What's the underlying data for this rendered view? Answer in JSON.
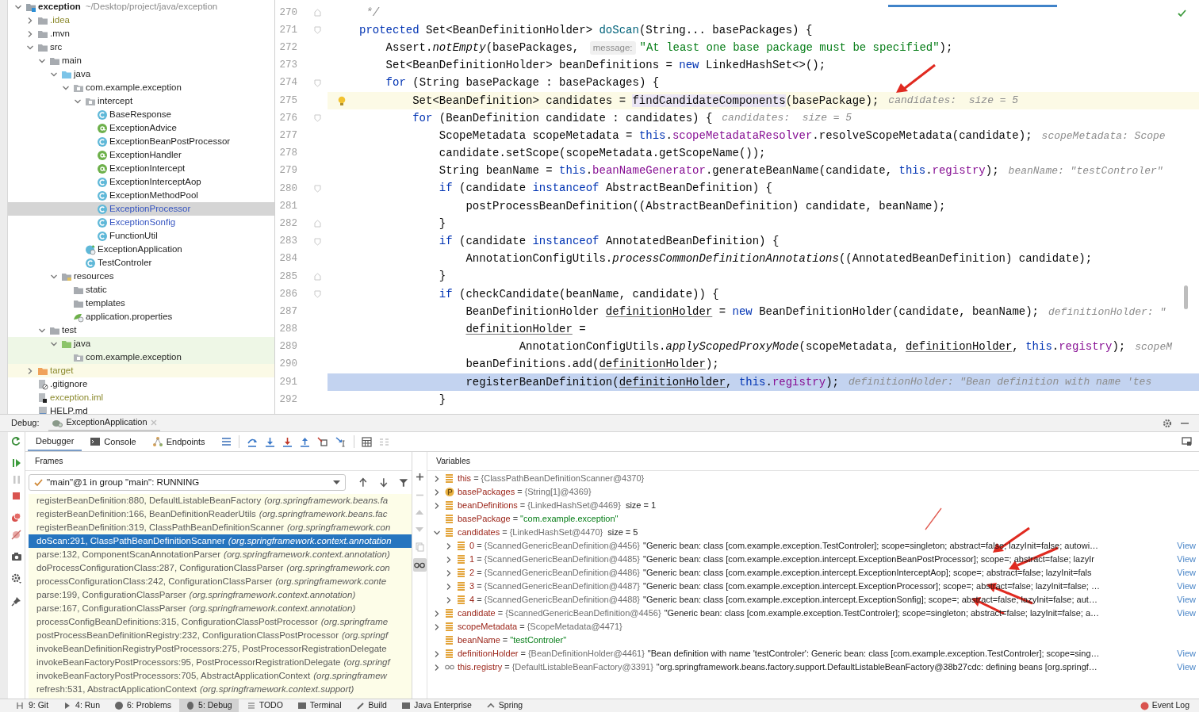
{
  "project_tree": [
    {
      "label": "exception",
      "path": "~/Desktop/project/java/exception",
      "kind": "module",
      "expanded": true,
      "selected": false,
      "children": [
        {
          "label": ".idea",
          "kind": "folder",
          "expanded": false,
          "selected": false,
          "ignored": true
        },
        {
          "label": ".mvn",
          "kind": "folder",
          "expanded": false,
          "selected": false
        },
        {
          "label": "src",
          "kind": "folder",
          "expanded": true,
          "selected": false,
          "children": [
            {
              "label": "main",
              "kind": "folder",
              "expanded": true,
              "selected": false,
              "children": [
                {
                  "label": "java",
                  "kind": "source_folder",
                  "expanded": true,
                  "selected": false,
                  "children": [
                    {
                      "label": "com.example.exception",
                      "kind": "package",
                      "expanded": true,
                      "selected": false,
                      "children": [
                        {
                          "label": "intercept",
                          "kind": "package",
                          "expanded": true,
                          "selected": false,
                          "children": [
                            {
                              "label": "BaseResponse",
                              "kind": "class",
                              "selected": false
                            },
                            {
                              "label": "ExceptionAdvice",
                              "kind": "annotation",
                              "selected": false
                            },
                            {
                              "label": "ExceptionBeanPostProcessor",
                              "kind": "class",
                              "selected": false
                            },
                            {
                              "label": "ExceptionHandler",
                              "kind": "annotation",
                              "selected": false
                            },
                            {
                              "label": "ExceptionIntercept",
                              "kind": "annotation",
                              "selected": false
                            },
                            {
                              "label": "ExceptionInterceptAop",
                              "kind": "class",
                              "selected": false
                            },
                            {
                              "label": "ExceptionMethodPool",
                              "kind": "class",
                              "selected": false
                            },
                            {
                              "label": "ExceptionProcessor",
                              "kind": "class",
                              "selected": true,
                              "modified": true
                            },
                            {
                              "label": "ExceptionSonfig",
                              "kind": "class",
                              "selected": false,
                              "modified": true
                            },
                            {
                              "label": "FunctionUtil",
                              "kind": "class",
                              "selected": false
                            }
                          ]
                        },
                        {
                          "label": "ExceptionApplication",
                          "kind": "spring_app",
                          "selected": false
                        },
                        {
                          "label": "TestControler",
                          "kind": "class",
                          "selected": false
                        }
                      ]
                    }
                  ]
                },
                {
                  "label": "resources",
                  "kind": "resources",
                  "expanded": true,
                  "selected": false,
                  "children": [
                    {
                      "label": "static",
                      "kind": "folder",
                      "selected": false
                    },
                    {
                      "label": "templates",
                      "kind": "folder",
                      "selected": false
                    },
                    {
                      "label": "application.properties",
                      "kind": "properties",
                      "selected": false
                    }
                  ]
                }
              ]
            },
            {
              "label": "test",
              "kind": "folder",
              "expanded": true,
              "selected": false,
              "children": [
                {
                  "label": "java",
                  "kind": "test_folder",
                  "expanded": true,
                  "selected": false,
                  "test_scope": true,
                  "children": [
                    {
                      "label": "com.example.exception",
                      "kind": "package",
                      "selected": false,
                      "test_scope": true
                    }
                  ]
                }
              ]
            }
          ]
        },
        {
          "label": "target",
          "kind": "excluded_folder",
          "expanded": false,
          "selected": false,
          "ignored": true,
          "excluded": true
        },
        {
          "label": ".gitignore",
          "kind": "ignore_file",
          "selected": false
        },
        {
          "label": "exception.iml",
          "kind": "iml_file",
          "selected": false,
          "ignored": true
        },
        {
          "label": "HELP.md",
          "kind": "markdown_file",
          "selected": false
        }
      ]
    }
  ],
  "editor": {
    "lines": [
      {
        "number": "270",
        "fold_end": true,
        "tokens": [
          {
            "kind": "comment",
            "text": " */"
          }
        ]
      },
      {
        "number": "271",
        "fold_start": true,
        "tokens": [
          {
            "kind": "keyword",
            "text": "protected"
          },
          {
            "kind": "plain",
            "text": " Set<BeanDefinitionHolder> "
          },
          {
            "kind": "decl",
            "text": "doScan"
          },
          {
            "kind": "plain",
            "text": "(String... basePackages) {"
          }
        ]
      },
      {
        "number": "272",
        "tokens": [
          {
            "kind": "plain",
            "text": "    Assert."
          },
          {
            "kind": "static",
            "text": "notEmpty"
          },
          {
            "kind": "plain",
            "text": "(basePackages, "
          },
          {
            "kind": "param_hint",
            "text": "message:"
          },
          {
            "kind": "string",
            "text": "\"At least one base package must be specified\""
          },
          {
            "kind": "plain",
            "text": ");"
          }
        ]
      },
      {
        "number": "273",
        "tokens": [
          {
            "kind": "plain",
            "text": "    Set<BeanDefinitionHolder> beanDefinitions = "
          },
          {
            "kind": "keyword",
            "text": "new"
          },
          {
            "kind": "plain",
            "text": " LinkedHashSet<>();"
          }
        ]
      },
      {
        "number": "274",
        "fold_start": true,
        "tokens": [
          {
            "kind": "keyword",
            "text": "    for"
          },
          {
            "kind": "plain",
            "text": " (String basePackage : basePackages) {"
          }
        ]
      },
      {
        "number": "275",
        "current": true,
        "bulb": true,
        "tokens": [
          {
            "kind": "plain",
            "text": "        Set<BeanDefinition> candidates = "
          },
          {
            "kind": "match",
            "text": "findCandidateComponents"
          },
          {
            "kind": "plain",
            "text": "(basePackage);"
          },
          {
            "kind": "value_hint",
            "text": "candidates:  size = 5"
          }
        ]
      },
      {
        "number": "276",
        "fold_start": true,
        "tokens": [
          {
            "kind": "keyword",
            "text": "        for"
          },
          {
            "kind": "plain",
            "text": " (BeanDefinition candidate : candidates) {"
          },
          {
            "kind": "value_hint",
            "text": "candidates:  size = 5"
          }
        ]
      },
      {
        "number": "277",
        "tokens": [
          {
            "kind": "plain",
            "text": "            ScopeMetadata scopeMetadata = "
          },
          {
            "kind": "keyword",
            "text": "this"
          },
          {
            "kind": "plain",
            "text": "."
          },
          {
            "kind": "field",
            "text": "scopeMetadataResolver"
          },
          {
            "kind": "plain",
            "text": ".resolveScopeMetadata(candidate);"
          },
          {
            "kind": "value_hint",
            "text": "scopeMetadata: Scope"
          }
        ]
      },
      {
        "number": "278",
        "tokens": [
          {
            "kind": "plain",
            "text": "            candidate.setScope(scopeMetadata.getScopeName());"
          }
        ]
      },
      {
        "number": "279",
        "tokens": [
          {
            "kind": "plain",
            "text": "            String beanName = "
          },
          {
            "kind": "keyword",
            "text": "this"
          },
          {
            "kind": "plain",
            "text": "."
          },
          {
            "kind": "field",
            "text": "beanNameGenerator"
          },
          {
            "kind": "plain",
            "text": ".generateBeanName(candidate, "
          },
          {
            "kind": "keyword",
            "text": "this"
          },
          {
            "kind": "plain",
            "text": "."
          },
          {
            "kind": "field",
            "text": "registry"
          },
          {
            "kind": "plain",
            "text": ");"
          },
          {
            "kind": "value_hint",
            "text": "beanName: \"testControler\""
          }
        ]
      },
      {
        "number": "280",
        "fold_start": true,
        "tokens": [
          {
            "kind": "keyword",
            "text": "            if"
          },
          {
            "kind": "plain",
            "text": " (candidate "
          },
          {
            "kind": "keyword",
            "text": "instanceof"
          },
          {
            "kind": "plain",
            "text": " AbstractBeanDefinition) {"
          }
        ]
      },
      {
        "number": "281",
        "tokens": [
          {
            "kind": "plain",
            "text": "                postProcessBeanDefinition((AbstractBeanDefinition) candidate, beanName);"
          }
        ]
      },
      {
        "number": "282",
        "fold_end": true,
        "tokens": [
          {
            "kind": "plain",
            "text": "            }"
          }
        ]
      },
      {
        "number": "283",
        "fold_start": true,
        "tokens": [
          {
            "kind": "keyword",
            "text": "            if"
          },
          {
            "kind": "plain",
            "text": " (candidate "
          },
          {
            "kind": "keyword",
            "text": "instanceof"
          },
          {
            "kind": "plain",
            "text": " AnnotatedBeanDefinition) {"
          }
        ]
      },
      {
        "number": "284",
        "tokens": [
          {
            "kind": "plain",
            "text": "                AnnotationConfigUtils."
          },
          {
            "kind": "static",
            "text": "processCommonDefinitionAnnotations"
          },
          {
            "kind": "plain",
            "text": "((AnnotatedBeanDefinition) candidate);"
          }
        ]
      },
      {
        "number": "285",
        "fold_end": true,
        "tokens": [
          {
            "kind": "plain",
            "text": "            }"
          }
        ]
      },
      {
        "number": "286",
        "fold_start": true,
        "tokens": [
          {
            "kind": "keyword",
            "text": "            if"
          },
          {
            "kind": "plain",
            "text": " (checkCandidate(beanName, candidate)) {"
          }
        ]
      },
      {
        "number": "287",
        "tokens": [
          {
            "kind": "plain",
            "text": "                BeanDefinitionHolder "
          },
          {
            "kind": "reassigned",
            "text": "definitionHolder"
          },
          {
            "kind": "plain",
            "text": " = "
          },
          {
            "kind": "keyword",
            "text": "new"
          },
          {
            "kind": "plain",
            "text": " BeanDefinitionHolder(candidate, beanName);"
          },
          {
            "kind": "value_hint",
            "text": "definitionHolder: \""
          }
        ]
      },
      {
        "number": "288",
        "tokens": [
          {
            "kind": "reassigned",
            "text": "                definitionHolder"
          },
          {
            "kind": "plain",
            "text": " ="
          }
        ]
      },
      {
        "number": "289",
        "tokens": [
          {
            "kind": "plain",
            "text": "                        AnnotationConfigUtils."
          },
          {
            "kind": "static",
            "text": "applyScopedProxyMode"
          },
          {
            "kind": "plain",
            "text": "(scopeMetadata, "
          },
          {
            "kind": "reassigned",
            "text": "definitionHolder"
          },
          {
            "kind": "plain",
            "text": ", "
          },
          {
            "kind": "keyword",
            "text": "this"
          },
          {
            "kind": "plain",
            "text": "."
          },
          {
            "kind": "field",
            "text": "registry"
          },
          {
            "kind": "plain",
            "text": ");"
          },
          {
            "kind": "value_hint",
            "text": "scopeM"
          }
        ]
      },
      {
        "number": "290",
        "tokens": [
          {
            "kind": "plain",
            "text": "                beanDefinitions.add("
          },
          {
            "kind": "reassigned",
            "text": "definitionHolder"
          },
          {
            "kind": "plain",
            "text": ");"
          }
        ]
      },
      {
        "number": "291",
        "execution_point": true,
        "tokens": [
          {
            "kind": "plain",
            "text": "                registerBeanDefinition("
          },
          {
            "kind": "reassigned",
            "text": "definitionHolder"
          },
          {
            "kind": "plain",
            "text": ", "
          },
          {
            "kind": "keyword",
            "text": "this"
          },
          {
            "kind": "plain",
            "text": "."
          },
          {
            "kind": "field",
            "text": "registry"
          },
          {
            "kind": "plain",
            "text": ");"
          },
          {
            "kind": "value_hint",
            "text": "definitionHolder: \"Bean definition with name 'tes"
          }
        ]
      },
      {
        "number": "292",
        "tokens": [
          {
            "kind": "plain",
            "text": "            }"
          }
        ]
      }
    ]
  },
  "debug": {
    "label": "Debug:",
    "session_tab": "ExceptionApplication",
    "tabs": [
      {
        "label": "Debugger",
        "selected": true,
        "kind": "plain"
      },
      {
        "label": "Console",
        "selected": false,
        "kind": "console"
      },
      {
        "label": "Endpoints",
        "selected": false,
        "kind": "endpoints"
      }
    ],
    "frames_title": "Frames",
    "thread": "\"main\"@1 in group \"main\": RUNNING",
    "frames": [
      {
        "method": "registerBeanDefinition:880, DefaultListableBeanFactory",
        "package": "(org.springframework.beans.fa",
        "selected": false
      },
      {
        "method": "registerBeanDefinition:166, BeanDefinitionReaderUtils",
        "package": "(org.springframework.beans.fac",
        "selected": false
      },
      {
        "method": "registerBeanDefinition:319, ClassPathBeanDefinitionScanner",
        "package": "(org.springframework.con",
        "selected": false
      },
      {
        "method": "doScan:291, ClassPathBeanDefinitionScanner",
        "package": "(org.springframework.context.annotation",
        "selected": true
      },
      {
        "method": "parse:132, ComponentScanAnnotationParser",
        "package": "(org.springframework.context.annotation)",
        "selected": false
      },
      {
        "method": "doProcessConfigurationClass:287, ConfigurationClassParser",
        "package": "(org.springframework.con",
        "selected": false
      },
      {
        "method": "processConfigurationClass:242, ConfigurationClassParser",
        "package": "(org.springframework.conte",
        "selected": false
      },
      {
        "method": "parse:199, ConfigurationClassParser",
        "package": "(org.springframework.context.annotation)",
        "selected": false
      },
      {
        "method": "parse:167, ConfigurationClassParser",
        "package": "(org.springframework.context.annotation)",
        "selected": false
      },
      {
        "method": "processConfigBeanDefinitions:315, ConfigurationClassPostProcessor",
        "package": "(org.springframe",
        "selected": false
      },
      {
        "method": "postProcessBeanDefinitionRegistry:232, ConfigurationClassPostProcessor",
        "package": "(org.springf",
        "selected": false
      },
      {
        "method": "invokeBeanDefinitionRegistryPostProcessors:275, PostProcessorRegistrationDelegate",
        "selected": false
      },
      {
        "method": "invokeBeanFactoryPostProcessors:95, PostProcessorRegistrationDelegate",
        "package": "(org.springf",
        "selected": false
      },
      {
        "method": "invokeBeanFactoryPostProcessors:705, AbstractApplicationContext",
        "package": "(org.springframew",
        "selected": false
      },
      {
        "method": "refresh:531, AbstractApplicationContext",
        "package": "(org.springframework.context.support)",
        "selected": false
      }
    ],
    "variables_title": "Variables",
    "variables": [
      {
        "name": "this",
        "kind": "field",
        "expanded": false,
        "operator": "=",
        "value": "{ClassPathBeanDefinitionScanner@4370}"
      },
      {
        "name": "basePackages",
        "kind": "parameter",
        "expanded": false,
        "operator": "=",
        "value": "{String[1]@4369}"
      },
      {
        "name": "beanDefinitions",
        "kind": "field",
        "expanded": false,
        "operator": "=",
        "value": "{LinkedHashSet@4469}",
        "extra": "size = 1"
      },
      {
        "name": "basePackage",
        "kind": "field",
        "operator": "=",
        "value": "\"com.example.exception\"",
        "value_is_string": true
      },
      {
        "name": "candidates",
        "kind": "field",
        "expanded": true,
        "operator": "=",
        "value": "{LinkedHashSet@4470}",
        "extra": "size = 5",
        "children": [
          {
            "name": "0",
            "kind": "field",
            "expanded": false,
            "operator": "=",
            "value": "{ScannedGenericBeanDefinition@4456}",
            "description": "\"Generic bean: class [com.example.exception.TestControler]; scope=singleton; abstract=false; lazyInit=false; autowi…",
            "link": "View"
          },
          {
            "name": "1",
            "kind": "field",
            "expanded": false,
            "operator": "=",
            "value": "{ScannedGenericBeanDefinition@4485}",
            "description": "\"Generic bean: class [com.example.exception.intercept.ExceptionBeanPostProcessor]; scope=; abstract=false; lazyIr",
            "link": "View"
          },
          {
            "name": "2",
            "kind": "field",
            "expanded": false,
            "operator": "=",
            "value": "{ScannedGenericBeanDefinition@4486}",
            "description": "\"Generic bean: class [com.example.exception.intercept.ExceptionInterceptAop]; scope=; abstract=false; lazyInit=fals",
            "link": "View"
          },
          {
            "name": "3",
            "kind": "field",
            "expanded": false,
            "operator": "=",
            "value": "{ScannedGenericBeanDefinition@4487}",
            "description": "\"Generic bean: class [com.example.exception.intercept.ExceptionProcessor]; scope=; abstract=false; lazyInit=false; …",
            "link": "View"
          },
          {
            "name": "4",
            "kind": "field",
            "expanded": false,
            "operator": "=",
            "value": "{ScannedGenericBeanDefinition@4488}",
            "description": "\"Generic bean: class [com.example.exception.intercept.ExceptionSonfig]; scope=; abstract=false; lazyInit=false; aut…",
            "link": "View"
          }
        ]
      },
      {
        "name": "candidate",
        "kind": "field",
        "expanded": false,
        "operator": "=",
        "value": "{ScannedGenericBeanDefinition@4456}",
        "description": "\"Generic bean: class [com.example.exception.TestControler]; scope=singleton; abstract=false; lazyInit=false; a…",
        "link": "View"
      },
      {
        "name": "scopeMetadata",
        "kind": "field",
        "expanded": false,
        "operator": "=",
        "value": "{ScopeMetadata@4471}"
      },
      {
        "name": "beanName",
        "kind": "field",
        "operator": "=",
        "value": "\"testControler\"",
        "value_is_string": true
      },
      {
        "name": "definitionHolder",
        "kind": "field",
        "expanded": false,
        "operator": "=",
        "value": "{BeanDefinitionHolder@4461}",
        "description": "\"Bean definition with name 'testControler': Generic bean: class [com.example.exception.TestControler]; scope=sing…",
        "link": "View"
      },
      {
        "name": "this.registry",
        "kind": "watch",
        "expanded": false,
        "operator": "=",
        "value": "{DefaultListableBeanFactory@3391}",
        "description": "\"org.springframework.beans.factory.support.DefaultListableBeanFactory@38b27cdc: defining beans [org.springf…",
        "link": "View"
      }
    ]
  },
  "tool_windows": [
    {
      "label": "9: Git",
      "selected": false
    },
    {
      "label": "4: Run",
      "selected": false
    },
    {
      "label": "6: Problems",
      "selected": false
    },
    {
      "label": "5: Debug",
      "selected": true
    },
    {
      "label": "TODO",
      "selected": false
    },
    {
      "label": "Terminal",
      "selected": false
    },
    {
      "label": "Build",
      "selected": false
    },
    {
      "label": "Java Enterprise",
      "selected": false
    },
    {
      "label": "Spring",
      "selected": false
    }
  ],
  "event_log": "Event Log"
}
